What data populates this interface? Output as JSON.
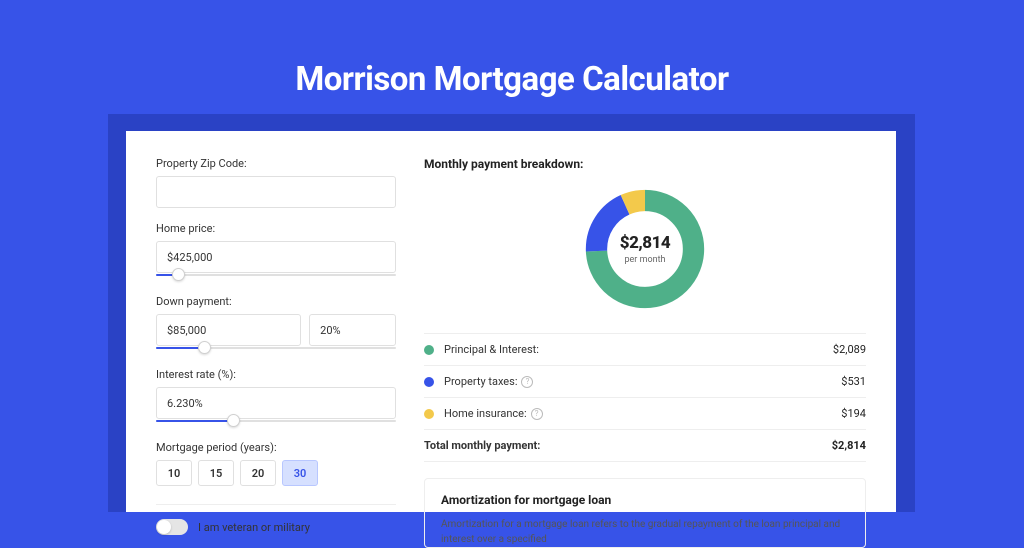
{
  "page_title": "Morrison Mortgage Calculator",
  "form": {
    "zip_label": "Property Zip Code:",
    "zip_value": "",
    "home_price_label": "Home price:",
    "home_price_value": "$425,000",
    "home_price_slider_pct": 9,
    "down_payment_label": "Down payment:",
    "down_payment_value": "$85,000",
    "down_payment_pct_value": "20%",
    "down_payment_slider_pct": 20,
    "interest_label": "Interest rate (%):",
    "interest_value": "6.230%",
    "interest_slider_pct": 32,
    "period_label": "Mortgage period (years):",
    "period_options": [
      "10",
      "15",
      "20",
      "30"
    ],
    "period_active_index": 3,
    "veteran_label": "I am veteran or military"
  },
  "breakdown": {
    "title": "Monthly payment breakdown:",
    "center_amount": "$2,814",
    "center_sub": "per month",
    "items": [
      {
        "label": "Principal & Interest:",
        "value": "$2,089",
        "color": "#4fb089",
        "has_info": false,
        "pct": 74.2
      },
      {
        "label": "Property taxes:",
        "value": "$531",
        "color": "#3753e8",
        "has_info": true,
        "pct": 18.9
      },
      {
        "label": "Home insurance:",
        "value": "$194",
        "color": "#f3c94b",
        "has_info": true,
        "pct": 6.9
      }
    ],
    "total_label": "Total monthly payment:",
    "total_value": "$2,814"
  },
  "amortization": {
    "title": "Amortization for mortgage loan",
    "text": "Amortization for a mortgage loan refers to the gradual repayment of the loan principal and interest over a specified"
  },
  "chart_data": {
    "type": "pie",
    "title": "Monthly payment breakdown",
    "series": [
      {
        "name": "Principal & Interest",
        "value": 2089,
        "color": "#4fb089"
      },
      {
        "name": "Property taxes",
        "value": 531,
        "color": "#3753e8"
      },
      {
        "name": "Home insurance",
        "value": 194,
        "color": "#f3c94b"
      }
    ],
    "total": 2814,
    "unit": "USD per month"
  }
}
